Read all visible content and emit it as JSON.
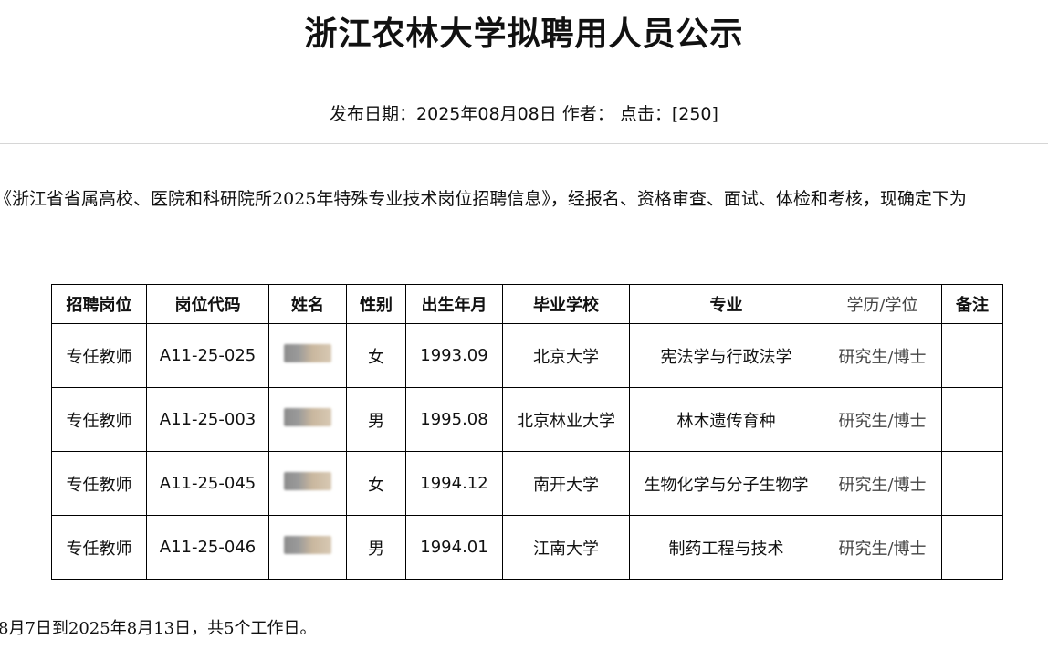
{
  "page": {
    "title": "浙江农林大学拟聘用人员公示",
    "meta": "发布日期：2025年08月08日 作者：  点击：[250]",
    "intro": "《浙江省省属高校、医院和科研院所2025年特殊专业技术岗位招聘信息》，经报名、资格审查、面试、体检和考核，现确定下为",
    "footer": "8月7日到2025年8月13日，共5个工作日。"
  },
  "table": {
    "headers": [
      "招聘岗位",
      "岗位代码",
      "姓名",
      "性别",
      "出生年月",
      "毕业学校",
      "专业",
      "学历/学位",
      "备注"
    ],
    "rows": [
      {
        "post": "专任教师",
        "code": "A11-25-025",
        "name": "",
        "gender": "女",
        "birth": "1993.09",
        "school": "北京大学",
        "major": "宪法学与行政法学",
        "degree": "研究生/博士",
        "note": ""
      },
      {
        "post": "专任教师",
        "code": "A11-25-003",
        "name": "",
        "gender": "男",
        "birth": "1995.08",
        "school": "北京林业大学",
        "major": "林木遗传育种",
        "degree": "研究生/博士",
        "note": ""
      },
      {
        "post": "专任教师",
        "code": "A11-25-045",
        "name": "",
        "gender": "女",
        "birth": "1994.12",
        "school": "南开大学",
        "major": "生物化学与分子生物学",
        "degree": "研究生/博士",
        "note": ""
      },
      {
        "post": "专任教师",
        "code": "A11-25-046",
        "name": "",
        "gender": "男",
        "birth": "1994.01",
        "school": "江南大学",
        "major": "制药工程与技术",
        "degree": "研究生/博士",
        "note": ""
      }
    ]
  }
}
